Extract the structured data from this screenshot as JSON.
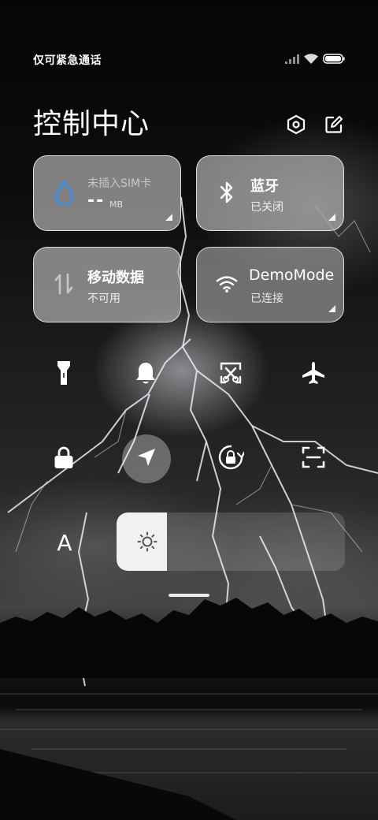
{
  "status_bar": {
    "carrier_text": "仅可紧急通话",
    "icons": [
      "signal-icon",
      "wifi-icon",
      "battery-icon"
    ]
  },
  "header": {
    "title": "控制中心",
    "icons": [
      "settings-icon",
      "edit-icon"
    ]
  },
  "tiles": {
    "sim": {
      "label": "未插入SIM卡",
      "value": "--",
      "unit": "MB",
      "icon": "water-drop-icon",
      "accent": "#3d8fe8"
    },
    "bluetooth": {
      "label": "蓝牙",
      "status": "已关闭",
      "icon": "bluetooth-icon"
    },
    "mobile_data": {
      "label": "移动数据",
      "status": "不可用",
      "icon": "data-arrows-icon"
    },
    "wifi": {
      "label": "DemoMode",
      "status": "已连接",
      "icon": "wifi-icon"
    }
  },
  "quick_toggles": {
    "row1": [
      "flashlight-icon",
      "bell-icon",
      "screenshot-icon",
      "airplane-icon"
    ],
    "row2": [
      "lock-icon",
      "location-icon",
      "rotation-lock-icon",
      "scan-icon"
    ],
    "active": [
      "location-icon"
    ]
  },
  "brightness": {
    "font_button": "A",
    "level": 0.22,
    "icon": "sun-icon"
  }
}
